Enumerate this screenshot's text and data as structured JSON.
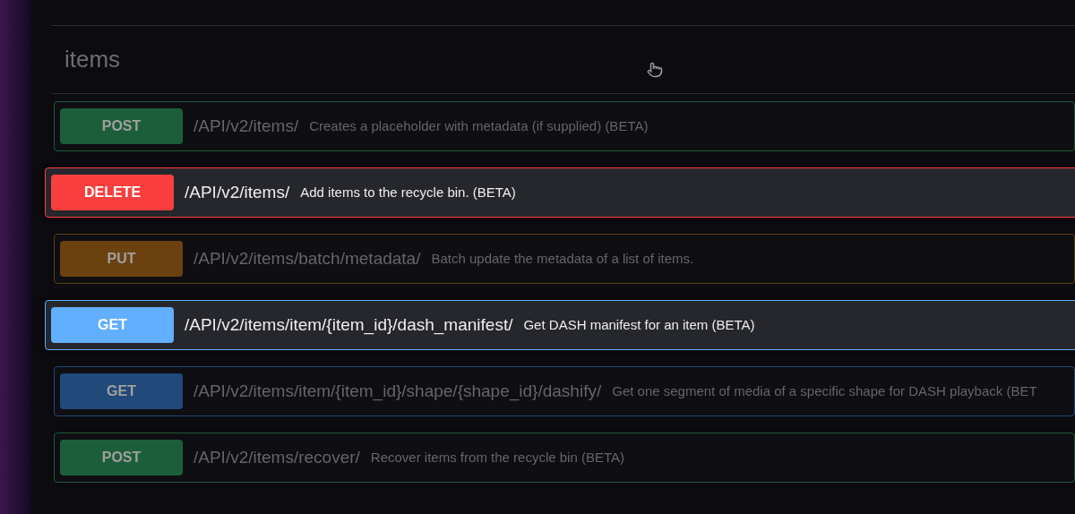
{
  "section": {
    "title": "items"
  },
  "operations": [
    {
      "method": "POST",
      "kind": "post",
      "path": "/API/v2/items/",
      "summary": "Creates a placeholder with metadata (if supplied) (BETA)",
      "highlighted": false
    },
    {
      "method": "DELETE",
      "kind": "delete",
      "path": "/API/v2/items/",
      "summary": "Add items to the recycle bin. (BETA)",
      "highlighted": true
    },
    {
      "method": "PUT",
      "kind": "put",
      "path": "/API/v2/items/batch/metadata/",
      "summary": "Batch update the metadata of a list of items.",
      "highlighted": false
    },
    {
      "method": "GET",
      "kind": "get",
      "path": "/API/v2/items/item/{item_id}/dash_manifest/",
      "summary": "Get DASH manifest for an item (BETA)",
      "highlighted": true
    },
    {
      "method": "GET",
      "kind": "get",
      "path": "/API/v2/items/item/{item_id}/shape/{shape_id}/dashify/",
      "summary": "Get one segment of media of a specific shape for DASH playback (BET",
      "highlighted": false
    },
    {
      "method": "POST",
      "kind": "post",
      "path": "/API/v2/items/recover/",
      "summary": "Recover items from the recycle bin (BETA)",
      "highlighted": false
    }
  ]
}
